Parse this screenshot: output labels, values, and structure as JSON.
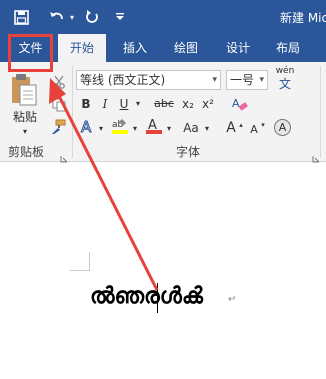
{
  "window": {
    "title": "新建 Mic"
  },
  "tabs": [
    {
      "label": "文件"
    },
    {
      "label": "开始"
    },
    {
      "label": "插入"
    },
    {
      "label": "绘图"
    },
    {
      "label": "设计"
    },
    {
      "label": "布局"
    }
  ],
  "clipboard": {
    "paste_label": "粘贴",
    "group_label": "剪贴板"
  },
  "font": {
    "name_value": "等线 (西文正文)",
    "size_value": "一号",
    "phonetic_top": "wén",
    "phonetic_char": "文",
    "bold": "B",
    "italic": "I",
    "underline": "U",
    "strike": "abc",
    "subscript": "x₂",
    "superscript": "x²",
    "case_label": "Aa",
    "grow": "A",
    "shrink": "A",
    "char_border": "A",
    "group_label": "字体"
  },
  "document": {
    "content": "ൽഞരൾൿ"
  },
  "colors": {
    "accent": "#2b579a",
    "annotation": "#e8413a",
    "highlight": "#ffff00",
    "font_color": "#e8413a"
  }
}
